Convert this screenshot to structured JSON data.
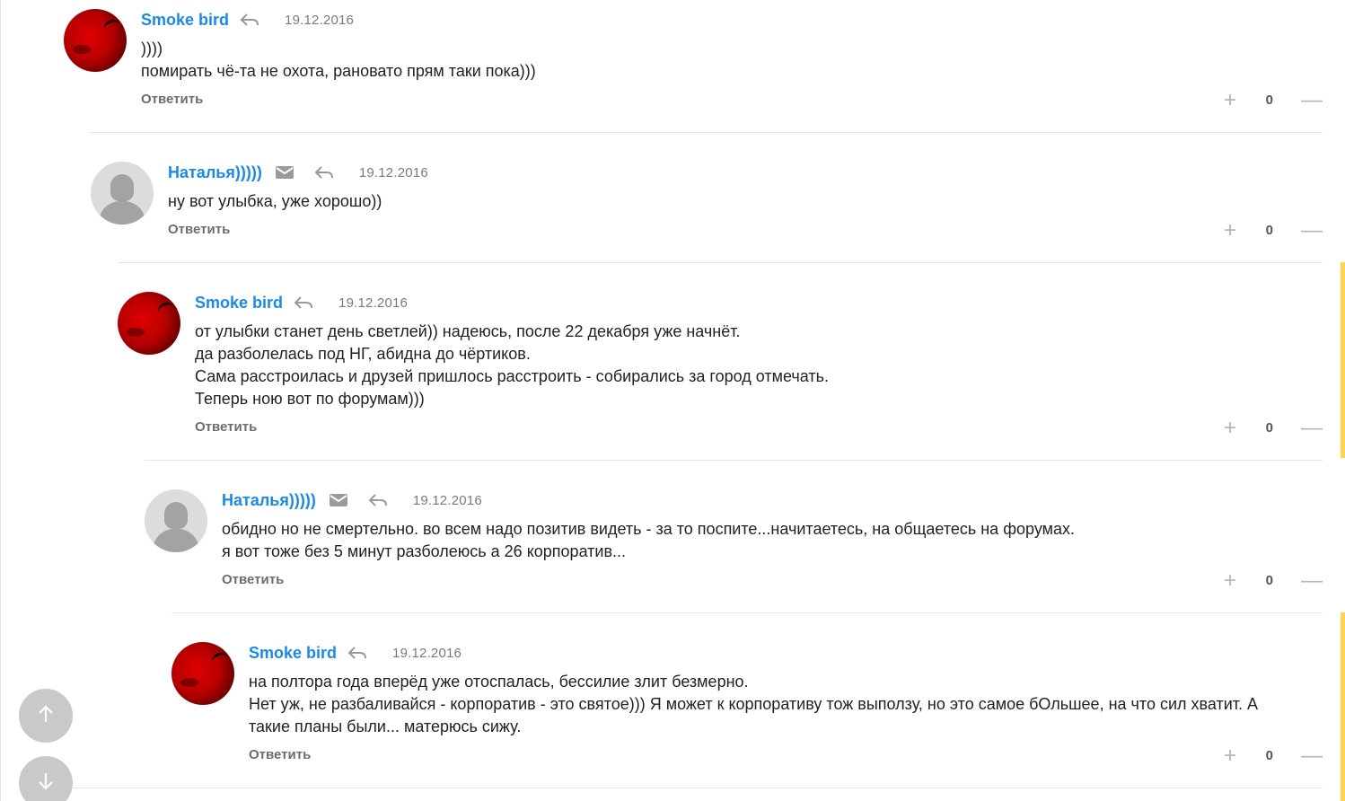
{
  "comments": [
    {
      "author": "Smoke bird",
      "date": "19.12.2016",
      "lines": [
        "))))",
        "помирать чё-та не охота, рановато прям таки пока)))"
      ],
      "reply": "Ответить",
      "score": "0",
      "avatar": "red-avatar",
      "has_mail": false
    },
    {
      "author": "Наталья)))))",
      "date": "19.12.2016",
      "lines": [
        "ну вот улыбка, уже хорошо))"
      ],
      "reply": "Ответить",
      "score": "0",
      "avatar": "default-female-avatar",
      "has_mail": true
    },
    {
      "author": "Smoke bird",
      "date": "19.12.2016",
      "lines": [
        "от улыбки станет день светлей)) надеюсь, после 22 декабря уже начнёт.",
        "да разболелась под НГ, абидна до чёртиков.",
        "Сама расстроилась и друзей пришлось расстроить - собирались за город отмечать.",
        "Теперь ною вот по форумам)))"
      ],
      "reply": "Ответить",
      "score": "0",
      "avatar": "red-avatar",
      "has_mail": false
    },
    {
      "author": "Наталья)))))",
      "date": "19.12.2016",
      "lines": [
        "обидно но не смертельно. во всем надо позитив видеть - за то поспите...начитаетесь, на общаетесь на форумах.",
        "я вот тоже без 5 минут разболеюсь а 26 корпоратив..."
      ],
      "reply": "Ответить",
      "score": "0",
      "avatar": "default-female-avatar",
      "has_mail": true
    },
    {
      "author": "Smoke bird",
      "date": "19.12.2016",
      "lines": [
        "на полтора года вперёд уже отоспалась, бессилие злит безмерно.",
        "Нет уж, не разбаливайся - корпоратив - это святое))) Я может к корпоративу тож выползу, но это самое бОльшее, на что сил хватит. А",
        "такие планы были... матерюсь сижу."
      ],
      "reply": "Ответить",
      "score": "0",
      "avatar": "red-avatar",
      "has_mail": false
    }
  ],
  "icons": {
    "reply": "reply-arrow-icon",
    "mail": "envelope-icon",
    "plus": "+",
    "minus": "—",
    "scroll_up": "arrow-up-icon",
    "scroll_down": "arrow-down-icon"
  },
  "colors": {
    "author": "#1e88e5",
    "accent_bar": "#ffd54f",
    "fab": "#c9c9c9"
  }
}
